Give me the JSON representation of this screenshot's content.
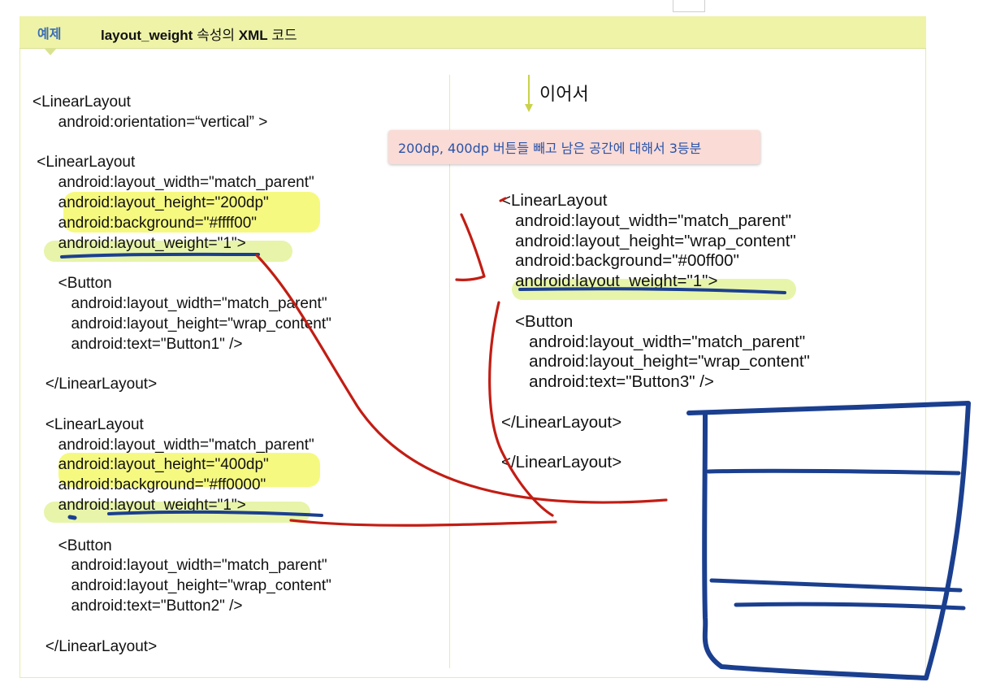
{
  "header": {
    "tag": "예제",
    "title_prefix": "layout_weight",
    "title_mid": " 속성의 ",
    "title_bold": "XML",
    "title_suffix": " 코드"
  },
  "left_code": [
    "<LinearLayout",
    "      android:orientation=“vertical” >",
    "",
    " <LinearLayout",
    "      android:layout_width=\"match_parent\"",
    "      android:layout_height=\"200dp\"",
    "      android:background=\"#ffff00\"",
    "      android:layout_weight=\"1\">",
    "",
    "      <Button",
    "         android:layout_width=\"match_parent\"",
    "         android:layout_height=\"wrap_content\"",
    "         android:text=\"Button1\" />",
    "",
    "   </LinearLayout>",
    "",
    "   <LinearLayout",
    "      android:layout_width=\"match_parent\"",
    "      android:layout_height=\"400dp\"",
    "      android:background=\"#ff0000\"",
    "      android:layout_weight=\"1\">",
    "",
    "      <Button",
    "         android:layout_width=\"match_parent\"",
    "         android:layout_height=\"wrap_content\"",
    "         android:text=\"Button2\" />",
    "",
    "   </LinearLayout>"
  ],
  "continued_label": "이어서",
  "note": "200dp, 400dp 버튼들 빼고 남은 공간에 대해서 3등분",
  "right_code": [
    "<LinearLayout",
    "   android:layout_width=\"match_parent\"",
    "   android:layout_height=\"wrap_content\"",
    "   android:background=\"#00ff00\"",
    "   android:layout_weight=\"1\">",
    "",
    "   <Button",
    "      android:layout_width=\"match_parent\"",
    "      android:layout_height=\"wrap_content\"",
    "      android:text=\"Button3\" />",
    "",
    "</LinearLayout>",
    "",
    "</LinearLayout>"
  ],
  "colors": {
    "header_bg": "#eef3a8",
    "highlight": "#f4f86a",
    "ink_red": "#c21d14",
    "ink_blue": "#1b3f8f",
    "note_bg": "#fadbd6",
    "note_text": "#2953a8",
    "tag_text": "#3b6db5"
  }
}
